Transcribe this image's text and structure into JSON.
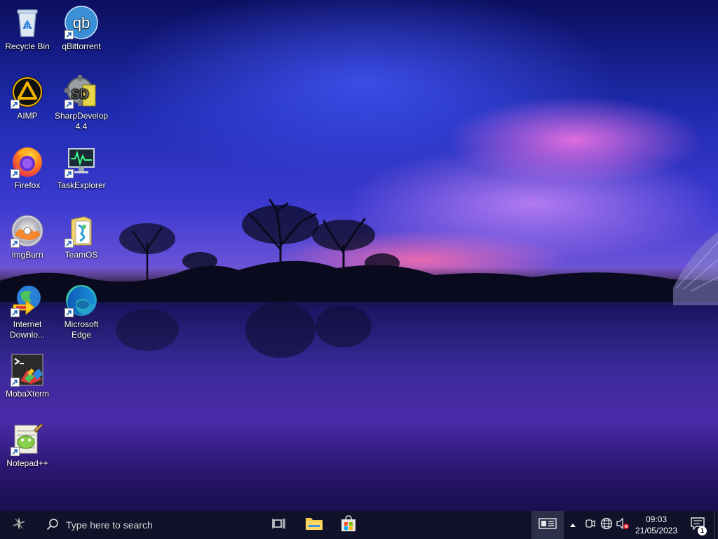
{
  "desktop": {
    "icons": [
      {
        "label": "Recycle Bin",
        "icon": "recycle-bin-icon"
      },
      {
        "label": "qBittorrent",
        "icon": "qbittorrent-icon"
      },
      {
        "label": "AIMP",
        "icon": "aimp-icon"
      },
      {
        "label": "SharpDevelop 4.4",
        "icon": "sharpdevelop-icon"
      },
      {
        "label": "Firefox",
        "icon": "firefox-icon"
      },
      {
        "label": "TaskExplorer",
        "icon": "taskexplorer-icon"
      },
      {
        "label": "ImgBurn",
        "icon": "imgburn-icon"
      },
      {
        "label": "TeamOS",
        "icon": "teamos-icon"
      },
      {
        "label": "Internet Downlo...",
        "icon": "internet-download-manager-icon"
      },
      {
        "label": "Microsoft Edge",
        "icon": "microsoft-edge-icon"
      },
      {
        "label": "MobaXterm",
        "icon": "mobaxterm-icon"
      },
      {
        "label": "Notepad++",
        "icon": "notepad-plus-plus-icon"
      }
    ],
    "qbittorrent_glyph": "qb",
    "sharpdevelop_glyph": "SD"
  },
  "taskbar": {
    "search_placeholder": "Type here to search",
    "clock_time": "09:03",
    "clock_date": "21/05/2023",
    "notification_count": "1"
  },
  "colors": {
    "taskbar_bg": "#0f1228",
    "accent": "#3b3ad0"
  }
}
